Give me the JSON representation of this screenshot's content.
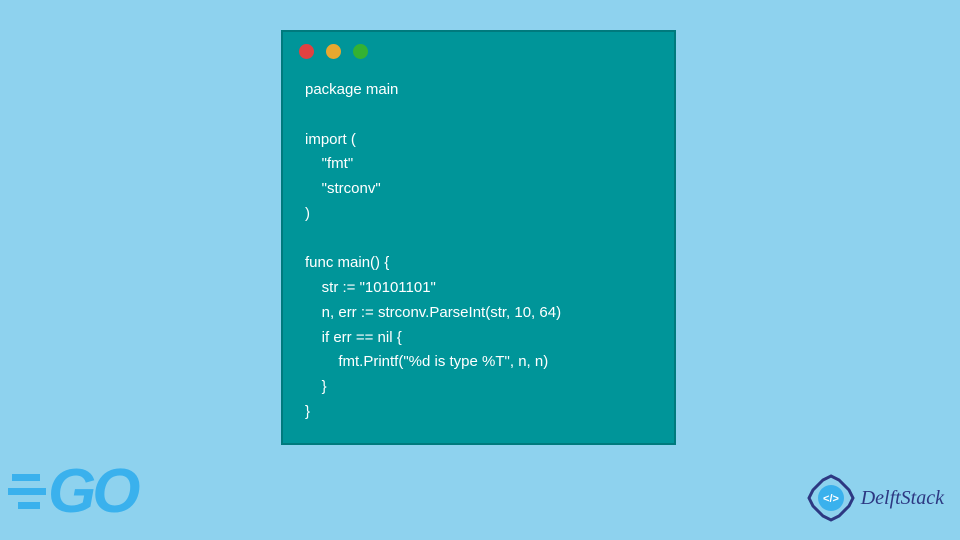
{
  "window": {
    "dots": [
      "red",
      "yellow",
      "green"
    ]
  },
  "code": {
    "line1": "package main",
    "line2": "",
    "line3": "import (",
    "line4": "    \"fmt\"",
    "line5": "    \"strconv\"",
    "line6": ")",
    "line7": "",
    "line8": "func main() {",
    "line9": "    str := \"10101101\"",
    "line10": "    n, err := strconv.ParseInt(str, 10, 64)",
    "line11": "    if err == nil {",
    "line12": "        fmt.Printf(\"%d is type %T\", n, n)",
    "line13": "    }",
    "line14": "}"
  },
  "logos": {
    "go_text": "GO",
    "delft_text": "DelftStack",
    "delft_icon_text": "</>"
  }
}
